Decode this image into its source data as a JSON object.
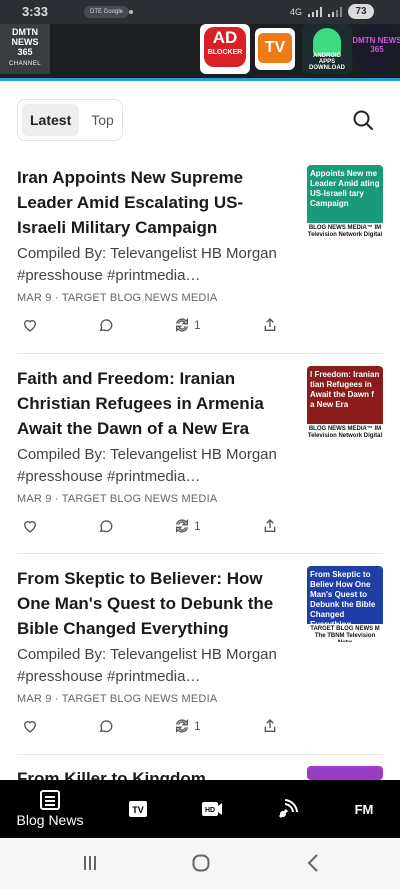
{
  "status_bar": {
    "time": "3:33",
    "notification": "DTE Google",
    "network": "4G",
    "battery": "73"
  },
  "header": {
    "brand": {
      "line1": "DMTN",
      "line2": "NEWS",
      "line3": "365",
      "line4": "CHANNEL"
    },
    "apps": [
      {
        "name": "AD BLOCKER",
        "label_main": "AD",
        "label_sub": "BLOCKER"
      },
      {
        "name": "TV",
        "label_main": "TV"
      },
      {
        "name": "ANDROID APPS DOWNLOAD",
        "label_main": "ANDROID",
        "label_sub": "APPS DOWNLOAD"
      },
      {
        "name": "DMTN NEWS 365",
        "label_main": "DMTN NEWS 365"
      }
    ],
    "accent_color": "#2a9fd6"
  },
  "tabs": [
    {
      "label": "Latest",
      "active": true
    },
    {
      "label": "Top",
      "active": false
    }
  ],
  "articles": [
    {
      "title": "Iran Appoints New Supreme Leader Amid Escalating US-Israeli Military Campaign",
      "excerpt": "Compiled By: Televangelist HB Morgan #presshouse #printmedia…",
      "meta": "MAR 9 · TARGET BLOG NEWS MEDIA",
      "restacks": "1",
      "thumb": {
        "headline": "Appoints New me Leader Amid ating US-Israeli tary Campaign",
        "footer": "BLOG NEWS MEDIA™ IM Television Network Digital",
        "color": "#1b9a7a"
      }
    },
    {
      "title": "Faith and Freedom: Iranian Christian Refugees in Armenia Await the Dawn of a New Era",
      "excerpt": "Compiled By: Televangelist HB Morgan #presshouse #printmedia…",
      "meta": "MAR 9 · TARGET BLOG NEWS MEDIA",
      "restacks": "1",
      "thumb": {
        "headline": "l Freedom: Iranian tian Refugees in Await the Dawn f a New Era",
        "footer": "BLOG NEWS MEDIA™ IM Television Network Digital",
        "color": "#8a1c1c"
      }
    },
    {
      "title": "From Skeptic to Believer: How One Man's Quest to Debunk the Bible Changed Everything",
      "excerpt": "Compiled By: Televangelist HB Morgan #presshouse #printmedia…",
      "meta": "MAR 9 · TARGET BLOG NEWS MEDIA",
      "restacks": "1",
      "thumb": {
        "headline": "From Skeptic to Believ How One Man's Quest to Debunk the Bible Changed Everything",
        "footer": "TARGET BLOG NEWS M The TBNM Television Netw",
        "color": "#1f3fa6"
      }
    },
    {
      "title": "From Killer to Kingdom",
      "excerpt": "",
      "meta": "",
      "restacks": "",
      "thumb": {
        "headline": "",
        "footer": "",
        "color": "#9a3cc4"
      }
    }
  ],
  "bottom_nav": [
    {
      "name": "Blog News",
      "label": "Blog News",
      "icon": "newspaper-icon",
      "active": true
    },
    {
      "name": "TV",
      "label": "",
      "icon": "tv-icon"
    },
    {
      "name": "HD",
      "label": "",
      "icon": "hd-video-icon"
    },
    {
      "name": "Podcast",
      "label": "",
      "icon": "broadcast-icon"
    },
    {
      "name": "FM",
      "label": "",
      "icon": "fm-radio-icon"
    }
  ]
}
